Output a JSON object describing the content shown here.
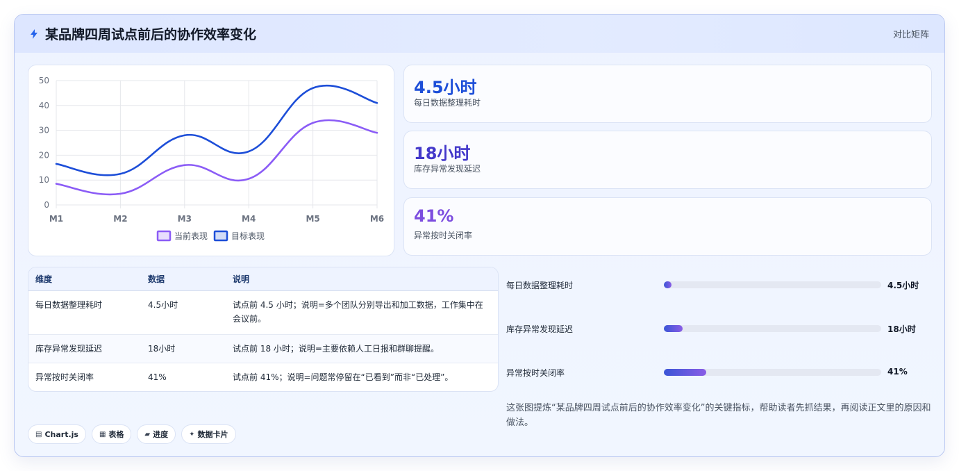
{
  "header": {
    "icon": "bolt-icon",
    "title": "某品牌四周试点前后的协作效率变化",
    "right_label": "对比矩阵"
  },
  "chart_data": {
    "type": "line",
    "x": [
      "M1",
      "M2",
      "M3",
      "M4",
      "M5",
      "M6"
    ],
    "series": [
      {
        "name": "当前表现",
        "values": [
          8.5,
          4.5,
          16,
          10.5,
          33,
          29
        ],
        "color": "#8b5cf6"
      },
      {
        "name": "目标表现",
        "values": [
          16.5,
          12.5,
          28,
          21.5,
          47,
          41
        ],
        "color": "#1d4ed8"
      }
    ],
    "ylim": [
      0,
      50
    ],
    "yticks": [
      "0",
      "10",
      "20",
      "30",
      "40",
      "50"
    ],
    "grid": true,
    "legend": "bottom"
  },
  "kpis": [
    {
      "value": "4.5小时",
      "label": "每日数据整理耗时",
      "color": "#1d4ed8"
    },
    {
      "value": "18小时",
      "label": "库存异常发现延迟",
      "color": "#4338ca"
    },
    {
      "value": "41%",
      "label": "异常按时关闭率",
      "color": "#7c4ddf"
    }
  ],
  "table": {
    "headers": [
      "维度",
      "数据",
      "说明"
    ],
    "rows": [
      [
        "每日数据整理耗时",
        "4.5小时",
        "试点前 4.5 小时；说明=多个团队分别导出和加工数据，工作集中在会议前。"
      ],
      [
        "库存异常发现延迟",
        "18小时",
        "试点前 18 小时；说明=主要依赖人工日报和群聊提醒。"
      ],
      [
        "异常按时关闭率",
        "41%",
        "试点前 41%；说明=问题常停留在“已看到”而非“已处理”。"
      ]
    ]
  },
  "progress": [
    {
      "label": "每日数据整理耗时",
      "value": "4.5小时",
      "fraction": 0.035
    },
    {
      "label": "库存异常发现延迟",
      "value": "18小时",
      "fraction": 0.085
    },
    {
      "label": "异常按时关闭率",
      "value": "41%",
      "fraction": 0.195
    }
  ],
  "summary": "这张图提炼“某品牌四周试点前后的协作效率变化”的关键指标，帮助读者先抓结果，再阅读正文里的原因和做法。",
  "tags": [
    {
      "icon": "chart-icon",
      "label": "Chart.js"
    },
    {
      "icon": "table-icon",
      "label": "表格"
    },
    {
      "icon": "progress-icon",
      "label": "进度"
    },
    {
      "icon": "sparkle-icon",
      "label": "数据卡片"
    }
  ]
}
